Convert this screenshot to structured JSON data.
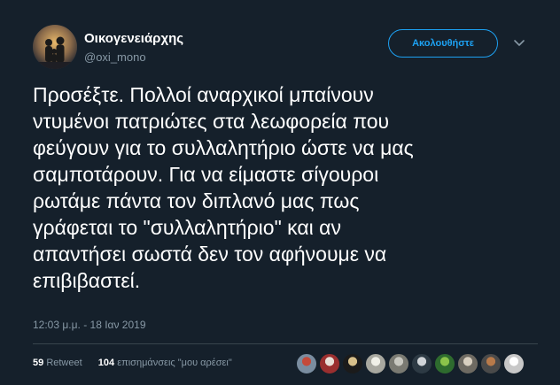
{
  "user": {
    "name": "Οικογενειάρχης",
    "handle": "@oxi_mono"
  },
  "follow_button": {
    "label": "Ακολουθήστε"
  },
  "tweet": {
    "lines": [
      "Προσέξτε. Πολλοί αναρχικοί μπαίνουν",
      "ντυμένοι πατριώτες στα λεωφορεία που",
      "φεύγουν για το συλλαλητήριο ώστε να μας",
      "σαμποτάρουν. Για να είμαστε σίγουροι",
      "ρωτάμε πάντα τον διπλανό μας πως",
      "γράφεται το \"συλλαλητήριο\" και αν",
      "απαντήσει σωστά δεν τον αφήνουμε να",
      "επιβιβαστεί."
    ],
    "timestamp": "12:03 μ.μ. - 18 Ιαν 2019"
  },
  "stats": {
    "retweets_count": "59",
    "retweets_label": "Retweet",
    "likes_count": "104",
    "likes_label": "επισημάνσεις \"μου αρέσει\""
  },
  "likers": [
    {
      "colors": [
        "#7a8da0",
        "#c44a3a"
      ]
    },
    {
      "colors": [
        "#9a2f2f",
        "#e8e0d8"
      ]
    },
    {
      "colors": [
        "#1b1b1b",
        "#d8c08a"
      ]
    },
    {
      "colors": [
        "#a8a8a0",
        "#f0f0e8"
      ]
    },
    {
      "colors": [
        "#7a7a72",
        "#c8c8c0"
      ]
    },
    {
      "colors": [
        "#2d3a44",
        "#d0d4d8"
      ]
    },
    {
      "colors": [
        "#2e6b2e",
        "#8bc34a"
      ]
    },
    {
      "colors": [
        "#6e6a62",
        "#d8cfc0"
      ]
    },
    {
      "colors": [
        "#4a4a4a",
        "#b87a4a"
      ]
    },
    {
      "colors": [
        "#c8c8c8",
        "#ffffff"
      ]
    }
  ],
  "colors": {
    "background": "#15202b",
    "accent": "#1da1f2",
    "secondary_text": "#8899a6"
  }
}
